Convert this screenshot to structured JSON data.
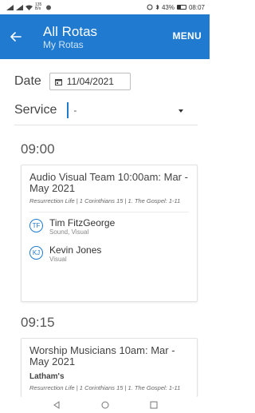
{
  "status_bar": {
    "left_text": "135 B/s",
    "battery": "43%",
    "time": "08:07"
  },
  "app_bar": {
    "title": "All Rotas",
    "subtitle": "My Rotas",
    "menu_label": "MENU"
  },
  "filters": {
    "date_label": "Date",
    "date_value": "11/04/2021",
    "service_label": "Service",
    "service_value": "-"
  },
  "sections": [
    {
      "time": "09:00",
      "card": {
        "title": "Audio Visual Team 10:00am: Mar - May 2021",
        "subtitle": "Resurrection Life | 1 Corinthians 15 | 1. The Gospel: 1-11",
        "people": [
          {
            "initials": "TF",
            "name": "Tim FitzGeorge",
            "role": "Sound, Visual"
          },
          {
            "initials": "KJ",
            "name": "Kevin Jones",
            "role": "Visual"
          }
        ]
      }
    },
    {
      "time": "09:15",
      "card": {
        "title": "Worship Musicians 10am: Mar - May 2021",
        "bold": "Latham's",
        "subtitle": "Resurrection Life | 1 Corinthians 15 | 1. The Gospel: 1-11"
      }
    }
  ],
  "colors": {
    "accent": "#1f7ad0"
  },
  "icons": {
    "back": "arrow-left-icon",
    "calendar": "calendar-icon",
    "nav_back": "triangle-back-icon",
    "nav_home": "circle-home-icon",
    "nav_recent": "square-recent-icon"
  }
}
